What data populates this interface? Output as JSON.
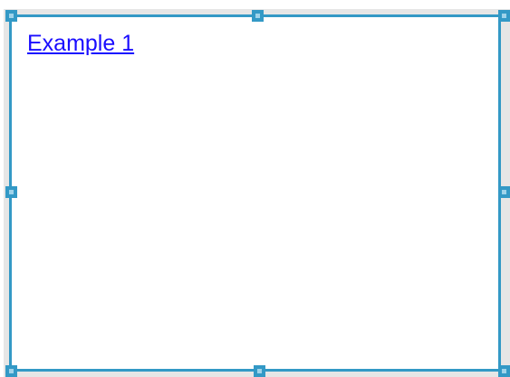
{
  "widget": {
    "link_text": "Example 1"
  },
  "colors": {
    "selection": "#3399c6",
    "handle_inner": "#9fd3ea",
    "gutter": "#e6e6e6",
    "link": "#1a0dff"
  },
  "handles": [
    {
      "name": "resize-handle-top-left"
    },
    {
      "name": "resize-handle-top-center"
    },
    {
      "name": "resize-handle-top-right"
    },
    {
      "name": "resize-handle-middle-left"
    },
    {
      "name": "resize-handle-middle-right"
    },
    {
      "name": "resize-handle-bottom-left"
    },
    {
      "name": "resize-handle-bottom-center"
    },
    {
      "name": "resize-handle-bottom-right"
    }
  ]
}
